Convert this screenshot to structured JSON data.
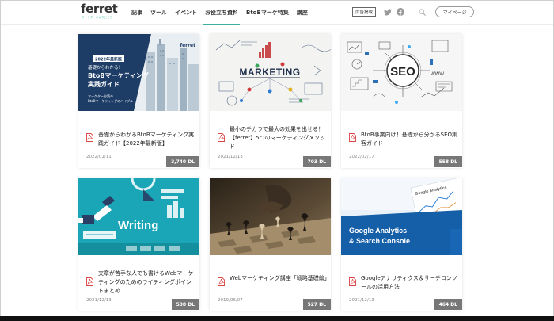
{
  "header": {
    "logo": "ferret",
    "logo_sub": "マーケターのよりどころ",
    "nav": [
      "記事",
      "ツール",
      "イベント",
      "お役立ち資料",
      "BtoBマーケ特集",
      "講座"
    ],
    "active_index": 3,
    "ad_label": "広告掲載",
    "mypage_label": "マイページ",
    "accent_color": "#3bb0a0"
  },
  "cards": [
    {
      "thumb": "btob-guide",
      "thumb_texts": {
        "badge": "2022年最新版",
        "line1": "基礎からわかる！",
        "line2": "BtoBマーケティング",
        "line3": "実践ガイド",
        "foot1": "マーケター必読の",
        "foot2": "BtoBマーケティングのバイブル",
        "brand": "ferret"
      },
      "title": "基礎からわかるBtoBマーケティング実践ガイド【2022年最新版】",
      "date": "2022/01/11",
      "downloads": "3,740 DL"
    },
    {
      "thumb": "marketing-board",
      "thumb_texts": {
        "word": "MARKETING"
      },
      "title": "最小のチカラで最大の効果を出せる！【ferret】5つのマーケティングメソッド",
      "date": "2021/12/13",
      "downloads": "703 DL"
    },
    {
      "thumb": "seo-sketch",
      "thumb_texts": {
        "word": "SEO",
        "www": "WWW"
      },
      "title": "BtoB事業向け！基礎から分かるSEO集客ガイド",
      "date": "2022/02/17",
      "downloads": "558 DL"
    },
    {
      "thumb": "writing",
      "thumb_texts": {
        "word": "Writing"
      },
      "title": "文章が苦手な人でも書けるWebマーケティングのためのライティングポイントまとめ",
      "date": "2021/12/13",
      "downloads": "538 DL"
    },
    {
      "thumb": "chess",
      "thumb_texts": {},
      "title": "Webマーケティング講座「戦略基礎編」",
      "date": "2019/06/07",
      "downloads": "527 DL"
    },
    {
      "thumb": "google-analytics",
      "thumb_texts": {
        "line1": "Google Analytics",
        "line2": "& Search Console",
        "paper": "Google Analytics"
      },
      "title": "Googleアナリティクス＆サーチコンソールの活用方法",
      "date": "2021/12/13",
      "downloads": "464 DL"
    }
  ]
}
